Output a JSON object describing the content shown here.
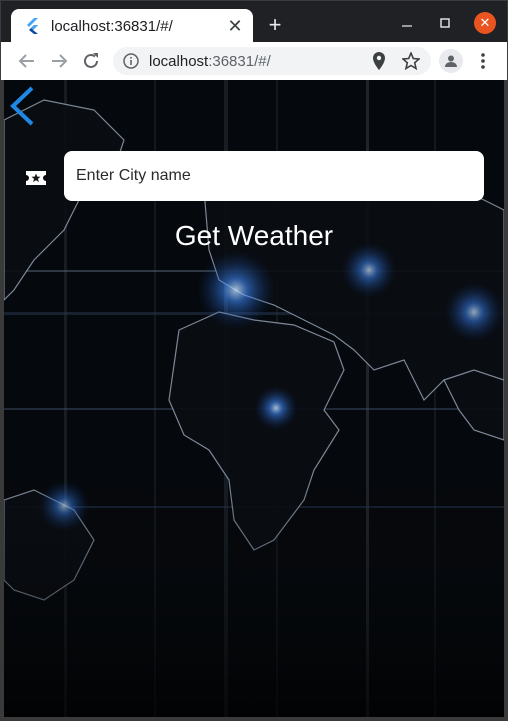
{
  "browser": {
    "tab_title": "localhost:36831/#/",
    "url_host": "localhost",
    "url_rest": ":36831/#/",
    "colors": {
      "chrome_dark": "#202124",
      "close_button": "#e95420"
    }
  },
  "page": {
    "search": {
      "placeholder": "Enter City name",
      "value": ""
    },
    "action_label": "Get Weather",
    "icons": {
      "back": "chevron-left-icon",
      "city_field": "ticket-star-icon"
    },
    "colors": {
      "back_arrow": "#1e88e5",
      "text": "#ffffff",
      "input_bg": "#ffffff"
    }
  }
}
